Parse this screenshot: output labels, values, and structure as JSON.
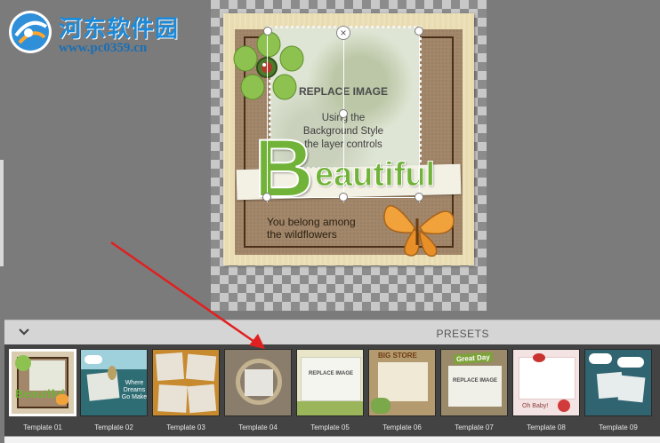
{
  "watermark": {
    "site_cn": "河东软件园",
    "url": "www.pc0359.cn"
  },
  "canvas": {
    "photo_title": "REPLACE IMAGE",
    "photo_lines": [
      "Using the",
      "Background Style",
      "the layer controls"
    ],
    "big_letter": "B",
    "word_rest": "eautiful",
    "subtitle_lines": [
      "You belong among",
      "the wildflowers"
    ],
    "close_glyph": "×"
  },
  "presets": {
    "title": "PRESETS",
    "templates": [
      {
        "label": "Template 01",
        "selected": true
      },
      {
        "label": "Template 02",
        "selected": false
      },
      {
        "label": "Template 03",
        "selected": false
      },
      {
        "label": "Template 04",
        "selected": false
      },
      {
        "label": "Template 05",
        "selected": false
      },
      {
        "label": "Template 06",
        "selected": false
      },
      {
        "label": "Template 07",
        "selected": false
      },
      {
        "label": "Template 08",
        "selected": false
      },
      {
        "label": "Template 09",
        "selected": false
      }
    ],
    "thumb_text": {
      "t01": "Beautiful",
      "t02": "Where Dreams Go Make",
      "t05": "REPLACE IMAGE",
      "t06": "BIG STORE",
      "t07_badge": "Great Day",
      "t07_title": "REPLACE IMAGE",
      "t08": "Oh Baby!"
    }
  },
  "colors": {
    "accent_green": "#71b338",
    "kraft": "#a3876a",
    "annotation_arrow": "#e02020",
    "watermark_blue": "#1c8ad8"
  }
}
